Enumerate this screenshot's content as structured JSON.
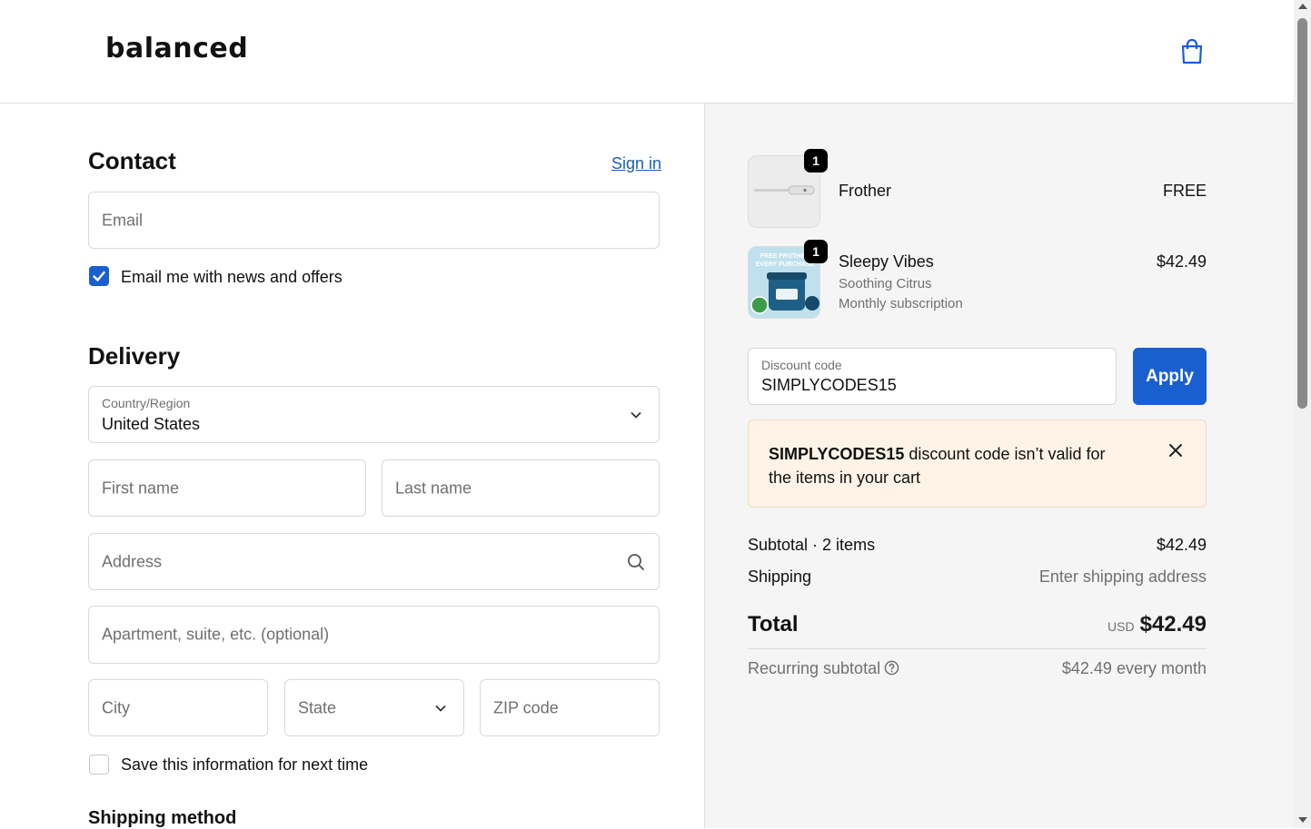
{
  "header": {
    "logo": "balanced",
    "cart_icon": "shopping-bag-icon"
  },
  "contact": {
    "title": "Contact",
    "sign_in": "Sign in",
    "email_placeholder": "Email",
    "news_checkbox_label": "Email me with news and offers",
    "news_checked": true
  },
  "delivery": {
    "title": "Delivery",
    "country_label": "Country/Region",
    "country_value": "United States",
    "first_name": "First name",
    "last_name": "Last name",
    "address": "Address",
    "apartment": "Apartment, suite, etc. (optional)",
    "city": "City",
    "state": "State",
    "zip": "ZIP code",
    "save_label": "Save this information for next time",
    "save_checked": false
  },
  "shipping_method": {
    "title": "Shipping method"
  },
  "order": {
    "items": [
      {
        "qty": "1",
        "name": "Frother",
        "price": "FREE"
      },
      {
        "qty": "1",
        "name": "Sleepy Vibes",
        "variant": "Soothing Citrus",
        "plan": "Monthly subscription",
        "price": "$42.49",
        "image_text": "FREE FROTHER EVERY PURCHASE"
      }
    ],
    "discount": {
      "label": "Discount code",
      "value": "SIMPLYCODES15",
      "apply": "Apply"
    },
    "alert": {
      "code": "SIMPLYCODES15",
      "message": "discount code isn’t valid for the items in your cart"
    },
    "subtotal_label": "Subtotal · 2 items",
    "subtotal_value": "$42.49",
    "shipping_label": "Shipping",
    "shipping_value": "Enter shipping address",
    "total_label": "Total",
    "total_currency": "USD",
    "total_value": "$42.49",
    "recurring_label": "Recurring subtotal",
    "recurring_value": "$42.49 every month"
  },
  "colors": {
    "accent": "#1a5fd0",
    "link": "#1a5fb4",
    "alert_bg": "#fdf3e6",
    "sidebar_bg": "#f5f5f5"
  }
}
